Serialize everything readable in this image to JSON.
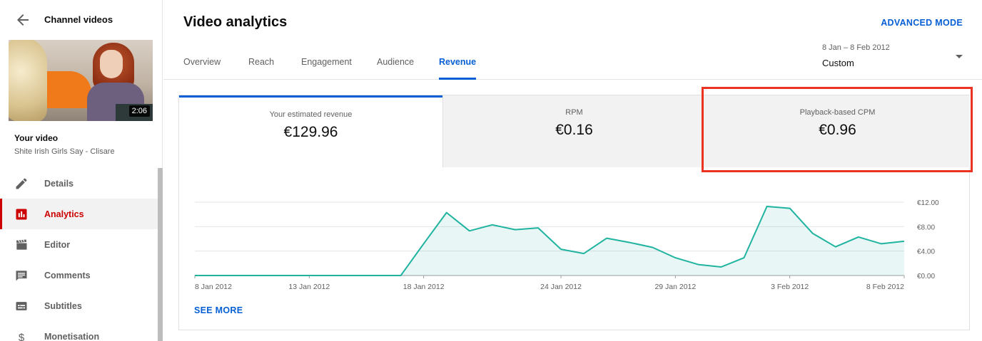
{
  "sidebar": {
    "back_title": "Channel videos",
    "thumbnail_duration": "2:06",
    "your_video_label": "Your video",
    "video_title": "Shite Irish Girls Say - Clisare",
    "items": [
      {
        "label": "Details",
        "icon": "pencil-icon"
      },
      {
        "label": "Analytics",
        "icon": "analytics-icon",
        "active": true
      },
      {
        "label": "Editor",
        "icon": "clapperboard-icon"
      },
      {
        "label": "Comments",
        "icon": "comment-icon"
      },
      {
        "label": "Subtitles",
        "icon": "subtitles-icon"
      },
      {
        "label": "Monetisation",
        "icon": "dollar-icon"
      }
    ]
  },
  "header": {
    "title": "Video analytics",
    "advanced_mode": "ADVANCED MODE",
    "tabs": [
      {
        "label": "Overview"
      },
      {
        "label": "Reach"
      },
      {
        "label": "Engagement"
      },
      {
        "label": "Audience"
      },
      {
        "label": "Revenue",
        "active": true
      }
    ],
    "date_range": "8 Jan – 8 Feb 2012",
    "date_preset": "Custom"
  },
  "metrics": [
    {
      "label": "Your estimated revenue",
      "value": "€129.96",
      "selected": true
    },
    {
      "label": "RPM",
      "value": "€0.16"
    },
    {
      "label": "Playback-based CPM",
      "value": "€0.96",
      "highlighted": true
    }
  ],
  "see_more": "SEE MORE",
  "colors": {
    "accent": "#065fd4",
    "active_nav": "#cc0000",
    "line": "#1fb3a0",
    "highlight_box": "#ea3323"
  },
  "chart_data": {
    "type": "area",
    "x_labels": [
      "8 Jan 2012",
      "13 Jan 2012",
      "18 Jan 2012",
      "24 Jan 2012",
      "29 Jan 2012",
      "3 Feb 2012",
      "8 Feb 2012"
    ],
    "y_ticks": [
      "€0.00",
      "€4.00",
      "€8.00",
      "€12.00"
    ],
    "ylim": [
      0,
      12
    ],
    "grid": true,
    "series": [
      {
        "x": [
          "8 Jan",
          "9 Jan",
          "10 Jan",
          "11 Jan",
          "12 Jan",
          "13 Jan",
          "14 Jan",
          "15 Jan",
          "16 Jan",
          "17 Jan",
          "18 Jan",
          "19 Jan",
          "20 Jan",
          "21 Jan",
          "22 Jan",
          "23 Jan",
          "24 Jan",
          "25 Jan",
          "26 Jan",
          "27 Jan",
          "28 Jan",
          "29 Jan",
          "30 Jan",
          "31 Jan",
          "1 Feb",
          "2 Feb",
          "3 Feb",
          "4 Feb",
          "5 Feb",
          "6 Feb",
          "7 Feb",
          "8 Feb"
        ],
        "values": [
          0,
          0,
          0,
          0,
          0,
          0,
          0,
          0,
          0,
          0,
          5.2,
          10.3,
          7.3,
          8.3,
          7.5,
          7.8,
          4.3,
          3.6,
          6.1,
          5.4,
          4.6,
          2.9,
          1.8,
          1.4,
          2.9,
          11.3,
          11.0,
          6.9,
          4.7,
          6.3,
          5.2,
          5.6
        ]
      }
    ]
  }
}
